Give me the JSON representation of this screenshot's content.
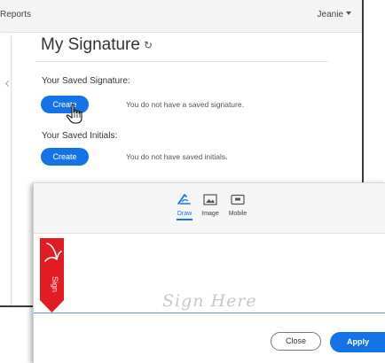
{
  "topbar": {
    "reports_label": "Reports",
    "user_name": "Jeanie"
  },
  "card": {
    "title": "My Signature"
  },
  "signature_section": {
    "label": "Your Saved Signature:",
    "create_label": "Create",
    "status": "You do not have a saved signature."
  },
  "initials_section": {
    "label": "Your Saved Initials:",
    "create_label": "Create",
    "status": "You do not have saved initials."
  },
  "dialog": {
    "tabs": [
      {
        "label": "Draw",
        "icon": "draw-pen-icon",
        "active": true
      },
      {
        "label": "Image",
        "icon": "image-icon",
        "active": false
      },
      {
        "label": "Mobile",
        "icon": "mobile-icon",
        "active": false
      }
    ],
    "ribbon_text": "Sign",
    "placeholder": "Sign Here",
    "close_label": "Close",
    "apply_label": "Apply"
  },
  "colors": {
    "accent": "#1473e6",
    "ribbon": "#e31b23",
    "line": "#6a8fc2"
  }
}
